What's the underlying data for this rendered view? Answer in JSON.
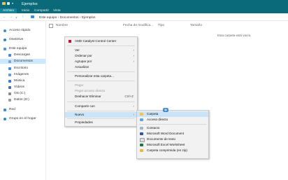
{
  "window": {
    "title": "Ejemplos"
  },
  "ribbon": {
    "tabs": [
      "Archivo",
      "Inicio",
      "Compartir",
      "Vista"
    ]
  },
  "address": {
    "breadcrumb": [
      "Este equipo",
      "Documentos",
      "Ejemplos"
    ]
  },
  "sidebar": {
    "items": [
      {
        "label": "Acceso rápido",
        "icon": "star-icon"
      },
      {
        "label": "OneDrive",
        "icon": "cloud-icon"
      },
      {
        "label": "Este equipo",
        "icon": "computer-icon"
      },
      {
        "label": "Descargas",
        "icon": "download-icon"
      },
      {
        "label": "Documentos",
        "icon": "document-icon"
      },
      {
        "label": "Escritorio",
        "icon": "folder-icon"
      },
      {
        "label": "Imágenes",
        "icon": "image-icon"
      },
      {
        "label": "Música",
        "icon": "music-icon"
      },
      {
        "label": "Vídeos",
        "icon": "video-icon"
      },
      {
        "label": "OS (C:)",
        "icon": "drive-icon"
      },
      {
        "label": "Datos (D:)",
        "icon": "drive-icon"
      },
      {
        "label": "Red",
        "icon": "network-icon"
      },
      {
        "label": "Grupo en el hogar",
        "icon": "homegroup-icon"
      }
    ]
  },
  "columns": [
    "Nombre",
    "Fecha de modifica...",
    "Tipo",
    "Tamaño"
  ],
  "empty_message": "Esta carpeta está vacía.",
  "context_menu": {
    "items": [
      {
        "label": "AMD Catalyst Control Center"
      },
      {
        "label": "Ver"
      },
      {
        "label": "Ordenar por"
      },
      {
        "label": "Agrupar por"
      },
      {
        "label": "Actualizar"
      },
      {
        "label": "Personalizar esta carpeta..."
      },
      {
        "label": "Pegar"
      },
      {
        "label": "Pegar acceso directo"
      },
      {
        "label": "Deshacer Eliminar",
        "shortcut": "Ctrl+Z"
      },
      {
        "label": "Compartir con"
      },
      {
        "label": "Nuevo"
      },
      {
        "label": "Propiedades"
      }
    ]
  },
  "submenu_new": {
    "items": [
      {
        "label": "Carpeta"
      },
      {
        "label": "Acceso directo"
      },
      {
        "label": "Contacto"
      },
      {
        "label": "Microsoft Word Document"
      },
      {
        "label": "Documento de texto"
      },
      {
        "label": "Microsoft Excel Worksheet"
      },
      {
        "label": "Carpeta comprimida (en zip)"
      }
    ]
  },
  "colors": {
    "titlebar": "#0b6a7a",
    "selection": "#cce8ff",
    "menu_highlight": "#cce4f7"
  }
}
